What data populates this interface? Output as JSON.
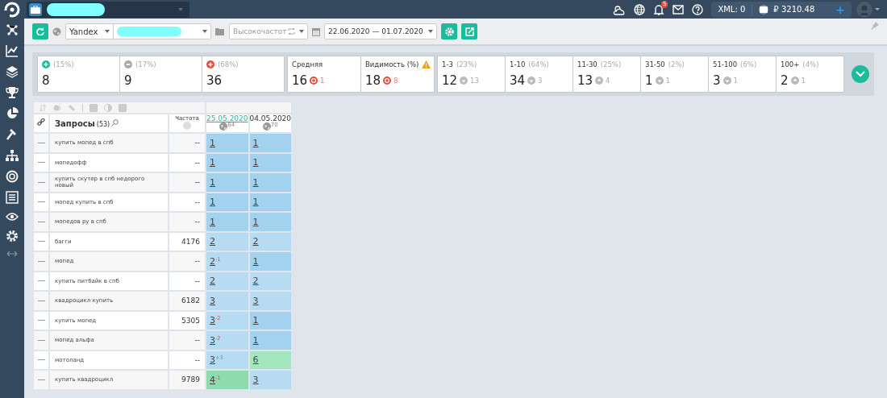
{
  "topbar": {
    "xml": "XML: 0",
    "balance": "₽ 3210.48",
    "plus": "+",
    "notifications": "5"
  },
  "toolbar": {
    "engine": "Yandex",
    "group": "Высокочастот",
    "dates": "22.06.2020 — 01.07.2020"
  },
  "summary": [
    {
      "kind": "up",
      "pct": "(15%)",
      "value": "8"
    },
    {
      "kind": "same",
      "pct": "(17%)",
      "value": "9"
    },
    {
      "kind": "down",
      "pct": "(68%)",
      "value": "36"
    }
  ],
  "metrics": [
    {
      "label": "Средняя",
      "warning": false,
      "value": "16",
      "delta": "1"
    },
    {
      "label": "Видимость (%)",
      "warning": true,
      "value": "18",
      "delta": "8"
    }
  ],
  "ranges": [
    {
      "label": "1-3",
      "pct": "(23%)",
      "value": "12",
      "rising": false,
      "delta": "13"
    },
    {
      "label": "1-10",
      "pct": "(64%)",
      "value": "34",
      "rising": false,
      "delta": "3"
    },
    {
      "label": "11-30",
      "pct": "(25%)",
      "value": "13",
      "rising": true,
      "delta": "4"
    },
    {
      "label": "31-50",
      "pct": "(2%)",
      "value": "1",
      "rising": false,
      "delta": "1"
    },
    {
      "label": "51-100",
      "pct": "(6%)",
      "value": "3",
      "rising": false,
      "delta": "1"
    },
    {
      "label": "100+",
      "pct": "(4%)",
      "value": "2",
      "rising": true,
      "delta": "1"
    }
  ],
  "table": {
    "query_header": "Запросы",
    "query_count": "(53)",
    "freq_header": "Частота",
    "dates": [
      {
        "date": "25.05.2020",
        "selected": true,
        "count": "64"
      },
      {
        "date": "04.05.2020",
        "selected": false,
        "count": "70"
      }
    ],
    "rows": [
      {
        "query": "купить мопед в спб",
        "freq": "--",
        "positions": [
          {
            "value": "1",
            "color": "#a3d2ef"
          },
          {
            "value": "1",
            "color": "#a3d2ef"
          }
        ]
      },
      {
        "query": "мопедофф",
        "freq": "--",
        "positions": [
          {
            "value": "1",
            "color": "#a3d2ef"
          },
          {
            "value": "1",
            "color": "#a3d2ef"
          }
        ]
      },
      {
        "query": "купить скутер в спб недорого новый",
        "freq": "--",
        "positions": [
          {
            "value": "1",
            "color": "#a3d2ef"
          },
          {
            "value": "1",
            "color": "#a3d2ef"
          }
        ]
      },
      {
        "query": "мопед купить в спб",
        "freq": "--",
        "positions": [
          {
            "value": "1",
            "color": "#a3d2ef"
          },
          {
            "value": "1",
            "color": "#a3d2ef"
          }
        ]
      },
      {
        "query": "мопедов ру в спб",
        "freq": "--",
        "positions": [
          {
            "value": "1",
            "color": "#a3d2ef"
          },
          {
            "value": "1",
            "color": "#a3d2ef"
          }
        ]
      },
      {
        "query": "багги",
        "freq": "4176",
        "positions": [
          {
            "value": "2",
            "color": "#b6dbf2"
          },
          {
            "value": "2",
            "color": "#b6dbf2"
          }
        ]
      },
      {
        "query": "мопед",
        "freq": "--",
        "positions": [
          {
            "value": "2",
            "color": "#b6dbf2",
            "change": "-1",
            "improved": false
          },
          {
            "value": "1",
            "color": "#a3d2ef"
          }
        ]
      },
      {
        "query": "купить питбайк в спб",
        "freq": "--",
        "positions": [
          {
            "value": "2",
            "color": "#b6dbf2"
          },
          {
            "value": "2",
            "color": "#b6dbf2"
          }
        ]
      },
      {
        "query": "квадроцикл купить",
        "freq": "6182",
        "positions": [
          {
            "value": "3",
            "color": "#b6dbf2"
          },
          {
            "value": "3",
            "color": "#b6dbf2"
          }
        ]
      },
      {
        "query": "купить мопед",
        "freq": "5305",
        "positions": [
          {
            "value": "3",
            "color": "#b6dbf2",
            "change": "-2",
            "improved": false
          },
          {
            "value": "1",
            "color": "#a3d2ef"
          }
        ]
      },
      {
        "query": "мопед альфа",
        "freq": "--",
        "positions": [
          {
            "value": "3",
            "color": "#b6dbf2",
            "change": "-2",
            "improved": false
          },
          {
            "value": "1",
            "color": "#a3d2ef"
          }
        ]
      },
      {
        "query": "мотоланд",
        "freq": "--",
        "positions": [
          {
            "value": "3",
            "color": "#b6dbf2",
            "change": "+3",
            "improved": true
          },
          {
            "value": "6",
            "color": "#a4e6c0"
          }
        ]
      },
      {
        "query": "купить квадроцикл",
        "freq": "9789",
        "positions": [
          {
            "value": "4",
            "color": "#8edcae",
            "change": "-1",
            "improved": false
          },
          {
            "value": "3",
            "color": "#b6dbf2"
          }
        ]
      }
    ]
  }
}
